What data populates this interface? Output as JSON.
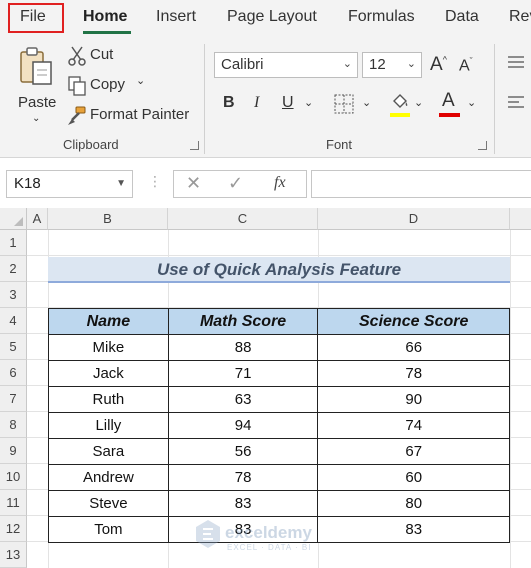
{
  "tabs": [
    {
      "label": "File"
    },
    {
      "label": "Home"
    },
    {
      "label": "Insert"
    },
    {
      "label": "Page Layout"
    },
    {
      "label": "Formulas"
    },
    {
      "label": "Data"
    },
    {
      "label": "Rev"
    }
  ],
  "clipboard": {
    "paste_label": "Paste",
    "cut_label": "Cut",
    "copy_label": "Copy",
    "format_painter_label": "Format Painter",
    "group_label": "Clipboard"
  },
  "font": {
    "family": "Calibri",
    "size": "12",
    "group_label": "Font",
    "bold": "B",
    "italic": "I",
    "underline": "U",
    "font_color_glyph": "A",
    "highlight_color": "#ffff00",
    "font_color": "#e00000"
  },
  "formula_bar": {
    "name_box": "K18",
    "fx": "fx",
    "value": ""
  },
  "grid": {
    "columns": [
      "A",
      "B",
      "C",
      "D"
    ],
    "rows": [
      "1",
      "2",
      "3",
      "4",
      "5",
      "6",
      "7",
      "8",
      "9",
      "10",
      "11",
      "12",
      "13"
    ]
  },
  "sheet": {
    "title": "Use of Quick Analysis Feature",
    "headers": [
      "Name",
      "Math Score",
      "Science Score"
    ],
    "rows": [
      [
        "Mike",
        "88",
        "66"
      ],
      [
        "Jack",
        "71",
        "78"
      ],
      [
        "Ruth",
        "63",
        "90"
      ],
      [
        "Lilly",
        "94",
        "74"
      ],
      [
        "Sara",
        "56",
        "67"
      ],
      [
        "Andrew",
        "78",
        "60"
      ],
      [
        "Steve",
        "83",
        "80"
      ],
      [
        "Tom",
        "83",
        "83"
      ]
    ]
  },
  "watermark": {
    "name": "exceldemy",
    "tagline": "EXCEL · DATA · BI"
  }
}
